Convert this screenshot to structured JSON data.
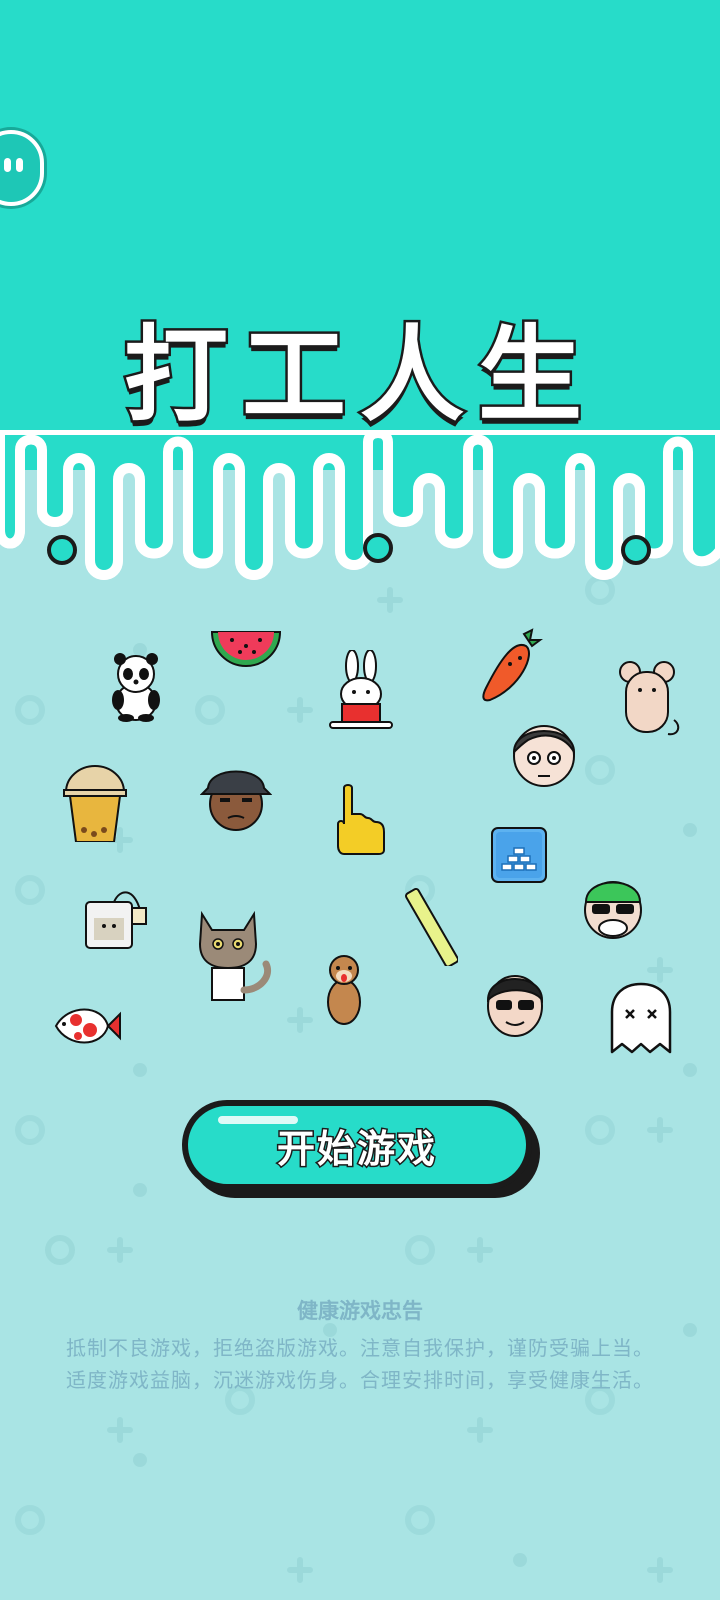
{
  "game": {
    "title": "打工人生",
    "start_button_label": "开始游戏"
  },
  "health_notice": {
    "title": "健康游戏忠告",
    "line1": "抵制不良游戏，拒绝盗版游戏。注意自我保护，谨防受骗上当。",
    "line2": "适度游戏益脑，沉迷游戏伤身。合理安排时间，享受健康生活。"
  },
  "stickers": [
    {
      "name": "panda-icon"
    },
    {
      "name": "watermelon-icon"
    },
    {
      "name": "rabbit-icon"
    },
    {
      "name": "carrot-icon"
    },
    {
      "name": "mouse-icon"
    },
    {
      "name": "bubble-tea-icon"
    },
    {
      "name": "man-with-hat-icon"
    },
    {
      "name": "pointing-hand-icon"
    },
    {
      "name": "slick-hair-man-icon"
    },
    {
      "name": "gold-bars-icon"
    },
    {
      "name": "tea-bag-icon"
    },
    {
      "name": "cat-icon"
    },
    {
      "name": "straw-icon"
    },
    {
      "name": "green-cap-man-icon"
    },
    {
      "name": "fish-icon"
    },
    {
      "name": "otter-icon"
    },
    {
      "name": "sunglasses-man-icon"
    },
    {
      "name": "ghost-icon"
    }
  ],
  "colors": {
    "top_band": "#27dcc9",
    "background": "#a9e4e4",
    "outline": "#1b1b1b",
    "notice_text": "#7fb6c7"
  }
}
